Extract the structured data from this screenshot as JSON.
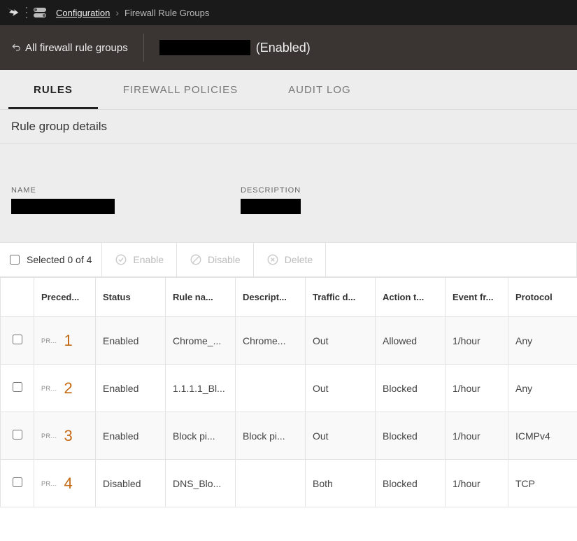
{
  "breadcrumb": {
    "parent": "Configuration",
    "current": "Firewall Rule Groups"
  },
  "subheader": {
    "back_label": "All firewall rule groups",
    "enabled_label": "(Enabled)"
  },
  "tabs": {
    "rules": "RULES",
    "policies": "FIREWALL POLICIES",
    "audit": "AUDIT LOG"
  },
  "section_title": "Rule group details",
  "details": {
    "name_label": "NAME",
    "desc_label": "DESCRIPTION"
  },
  "actions": {
    "selected_text": "Selected 0 of 4",
    "enable": "Enable",
    "disable": "Disable",
    "delete": "Delete"
  },
  "columns": {
    "precedence": "Preced...",
    "status": "Status",
    "rule_name": "Rule na...",
    "description": "Descript...",
    "traffic": "Traffic d...",
    "action": "Action t...",
    "event": "Event fr...",
    "protocol": "Protocol"
  },
  "rows": [
    {
      "prec_tag": "PR...",
      "prec_num": "1",
      "status": "Enabled",
      "rule_name": "Chrome_...",
      "description": "Chrome...",
      "traffic": "Out",
      "action": "Allowed",
      "event": "1/hour",
      "protocol": "Any"
    },
    {
      "prec_tag": "PR...",
      "prec_num": "2",
      "status": "Enabled",
      "rule_name": "1.1.1.1_Bl...",
      "description": "",
      "traffic": "Out",
      "action": "Blocked",
      "event": "1/hour",
      "protocol": "Any"
    },
    {
      "prec_tag": "PR...",
      "prec_num": "3",
      "status": "Enabled",
      "rule_name": "Block pi...",
      "description": "Block pi...",
      "traffic": "Out",
      "action": "Blocked",
      "event": "1/hour",
      "protocol": "ICMPv4"
    },
    {
      "prec_tag": "PR...",
      "prec_num": "4",
      "status": "Disabled",
      "rule_name": "DNS_Blo...",
      "description": "",
      "traffic": "Both",
      "action": "Blocked",
      "event": "1/hour",
      "protocol": "TCP"
    }
  ]
}
